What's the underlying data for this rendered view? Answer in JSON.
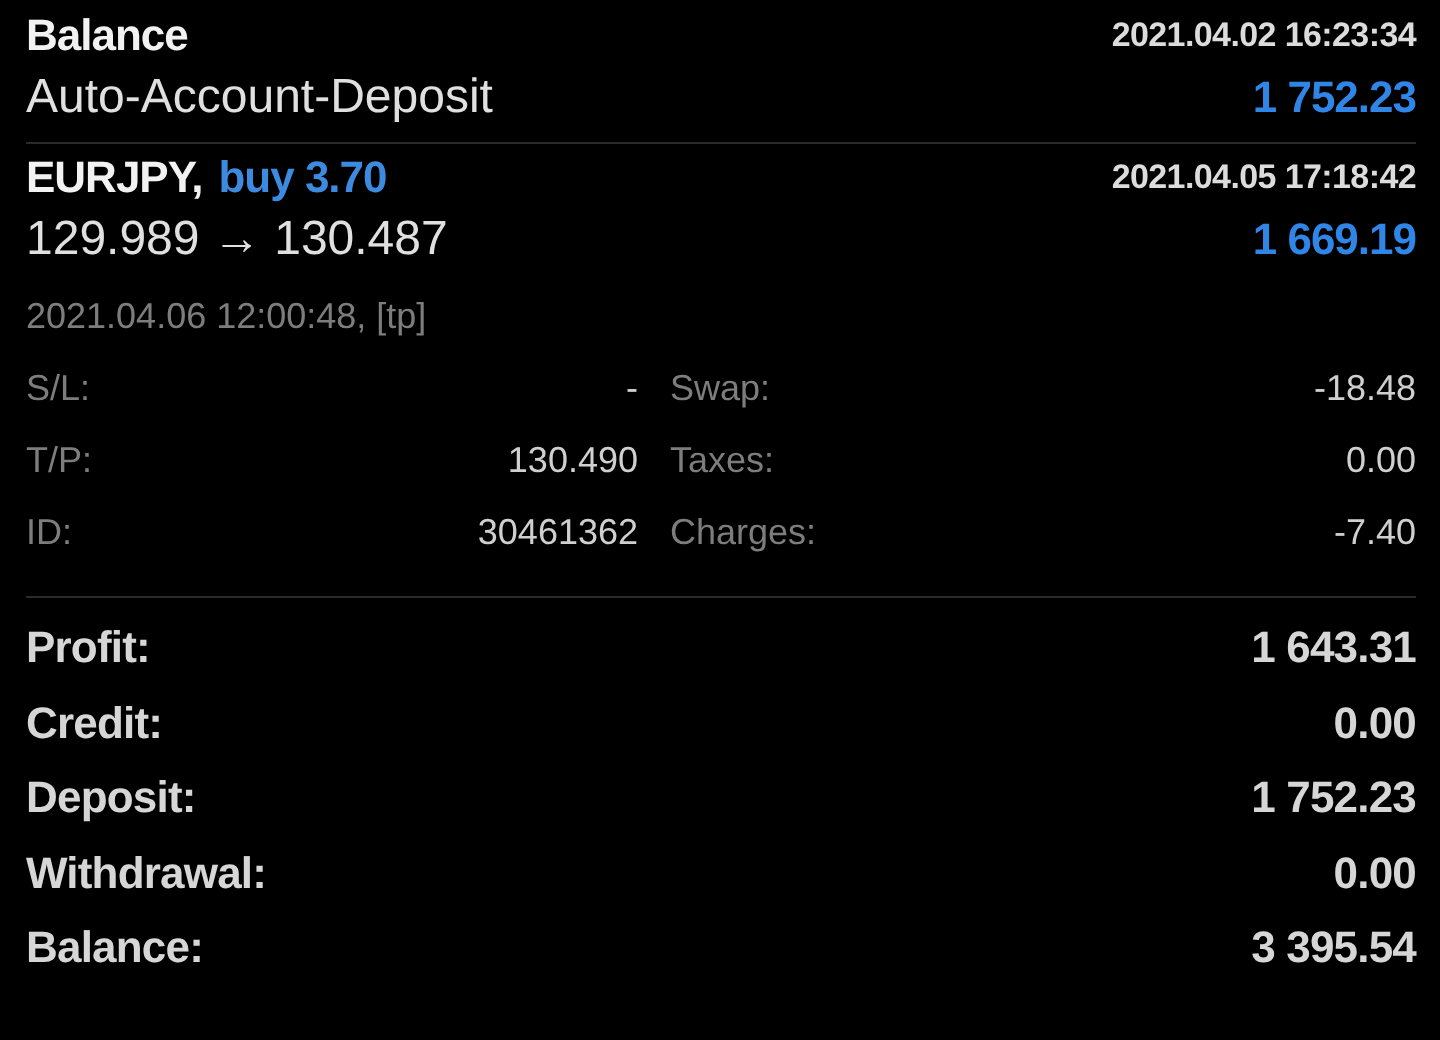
{
  "deals": [
    {
      "kind": "balance",
      "title": "Balance",
      "time": "2021.04.02 16:23:34",
      "comment": "Auto-Account-Deposit",
      "amount": "1 752.23"
    },
    {
      "kind": "trade",
      "title": "EURJPY,",
      "action": "buy 3.70",
      "time": "2021.04.05 17:18:42",
      "prices": "129.989 → 130.487",
      "amount": "1 669.19"
    }
  ],
  "close_info": "2021.04.06 12:00:48, [tp]",
  "details": [
    {
      "label": "S/L:",
      "value": "-",
      "label2": "Swap:",
      "value2": "-18.48"
    },
    {
      "label": "T/P:",
      "value": "130.490",
      "label2": "Taxes:",
      "value2": "0.00"
    },
    {
      "label": "ID:",
      "value": "30461362",
      "label2": "Charges:",
      "value2": "-7.40"
    }
  ],
  "summary": [
    {
      "label": "Profit:",
      "value": "1 643.31"
    },
    {
      "label": "Credit:",
      "value": "0.00"
    },
    {
      "label": "Deposit:",
      "value": "1 752.23"
    },
    {
      "label": "Withdrawal:",
      "value": "0.00"
    },
    {
      "label": "Balance:",
      "value": "3 395.54"
    }
  ]
}
